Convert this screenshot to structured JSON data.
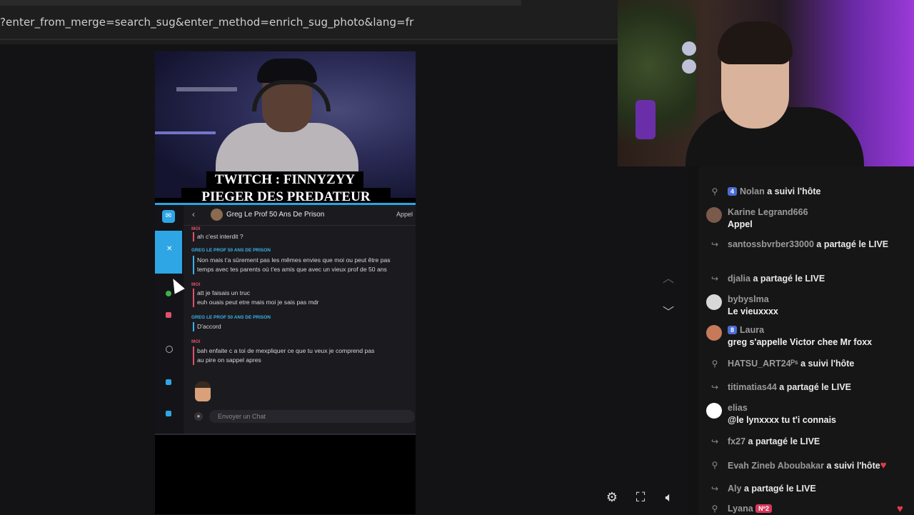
{
  "browser": {
    "url_text": "?enter_from_merge=search_sug&enter_method=enrich_sug_photo&lang=fr"
  },
  "video": {
    "banner_line1": "TWITCH : FINNYZYY",
    "banner_line2": "PIEGER DES PREDATEUR",
    "snap": {
      "contact_name": "Greg Le Prof 50 Ans De Prison",
      "call_label": "Appel",
      "messages": [
        {
          "sender": "MOI",
          "text": "ah c'est interdit ?"
        },
        {
          "sender": "GREG LE PROF 50 ANS DE PRISON",
          "text_line1": "Non mais t'a sûrement pas les mêmes envies que moi ou peut être pas",
          "text_line2": "temps avec tes parents où t'es amis que avec un vieux prof de 50 ans"
        },
        {
          "sender": "MOI",
          "text_line1": "att je faisais un truc",
          "text_line2": "euh ouais peut etre mais moi je sais pas mdr"
        },
        {
          "sender": "GREG LE PROF 50 ANS DE PRISON",
          "text": "D'accord"
        },
        {
          "sender": "MOI",
          "text_line1": "bah enfaite c a toi de mexpliquer ce que tu veux je comprend pas",
          "text_line2": "au pire on sappel apres"
        }
      ],
      "input_placeholder": "Envoyer un Chat"
    }
  },
  "controls": {
    "settings_icon": "gear-icon",
    "fullscreen_icon": "fullscreen-icon",
    "volume_icon": "volume-icon",
    "nav_up_icon": "chevron-up-icon",
    "nav_down_icon": "chevron-down-icon"
  },
  "chat": {
    "events": [
      {
        "badge": "4",
        "user": "Nolan",
        "action": "a suivi l'hôte"
      },
      {
        "user": "Karine Legrand666",
        "message": "Appel"
      },
      {
        "user": "santossbvrber33000",
        "action": "a partagé le LIVE"
      },
      {
        "user": "djalia",
        "action": "a partagé le LIVE"
      },
      {
        "user": "bybyslma",
        "message": "Le vieuxxxx"
      },
      {
        "badge": "8",
        "user": "Laura",
        "message": "greg s'appelle Victor chee Mr foxx"
      },
      {
        "user": "HATSU_ART24ᴾˢ",
        "action": "a suivi l'hôte"
      },
      {
        "user": "titimatias44",
        "action": "a partagé le LIVE"
      },
      {
        "user": "elias",
        "message": "@le lynxxxx tu t'i connais"
      },
      {
        "user": "fx27",
        "action": "a partagé le LIVE"
      },
      {
        "user": "Evah Zineb Aboubakar",
        "action": "a suivi l'hôte"
      },
      {
        "user": "Aly",
        "action": "a partagé le LIVE"
      },
      {
        "user": "Lyana",
        "badge": "Nº2"
      }
    ]
  },
  "colors": {
    "accent_blue": "#2ea6e6",
    "badge_blue": "#4a6cd4",
    "badge_pink": "#d8375a",
    "heart_red": "#e23b4b"
  }
}
